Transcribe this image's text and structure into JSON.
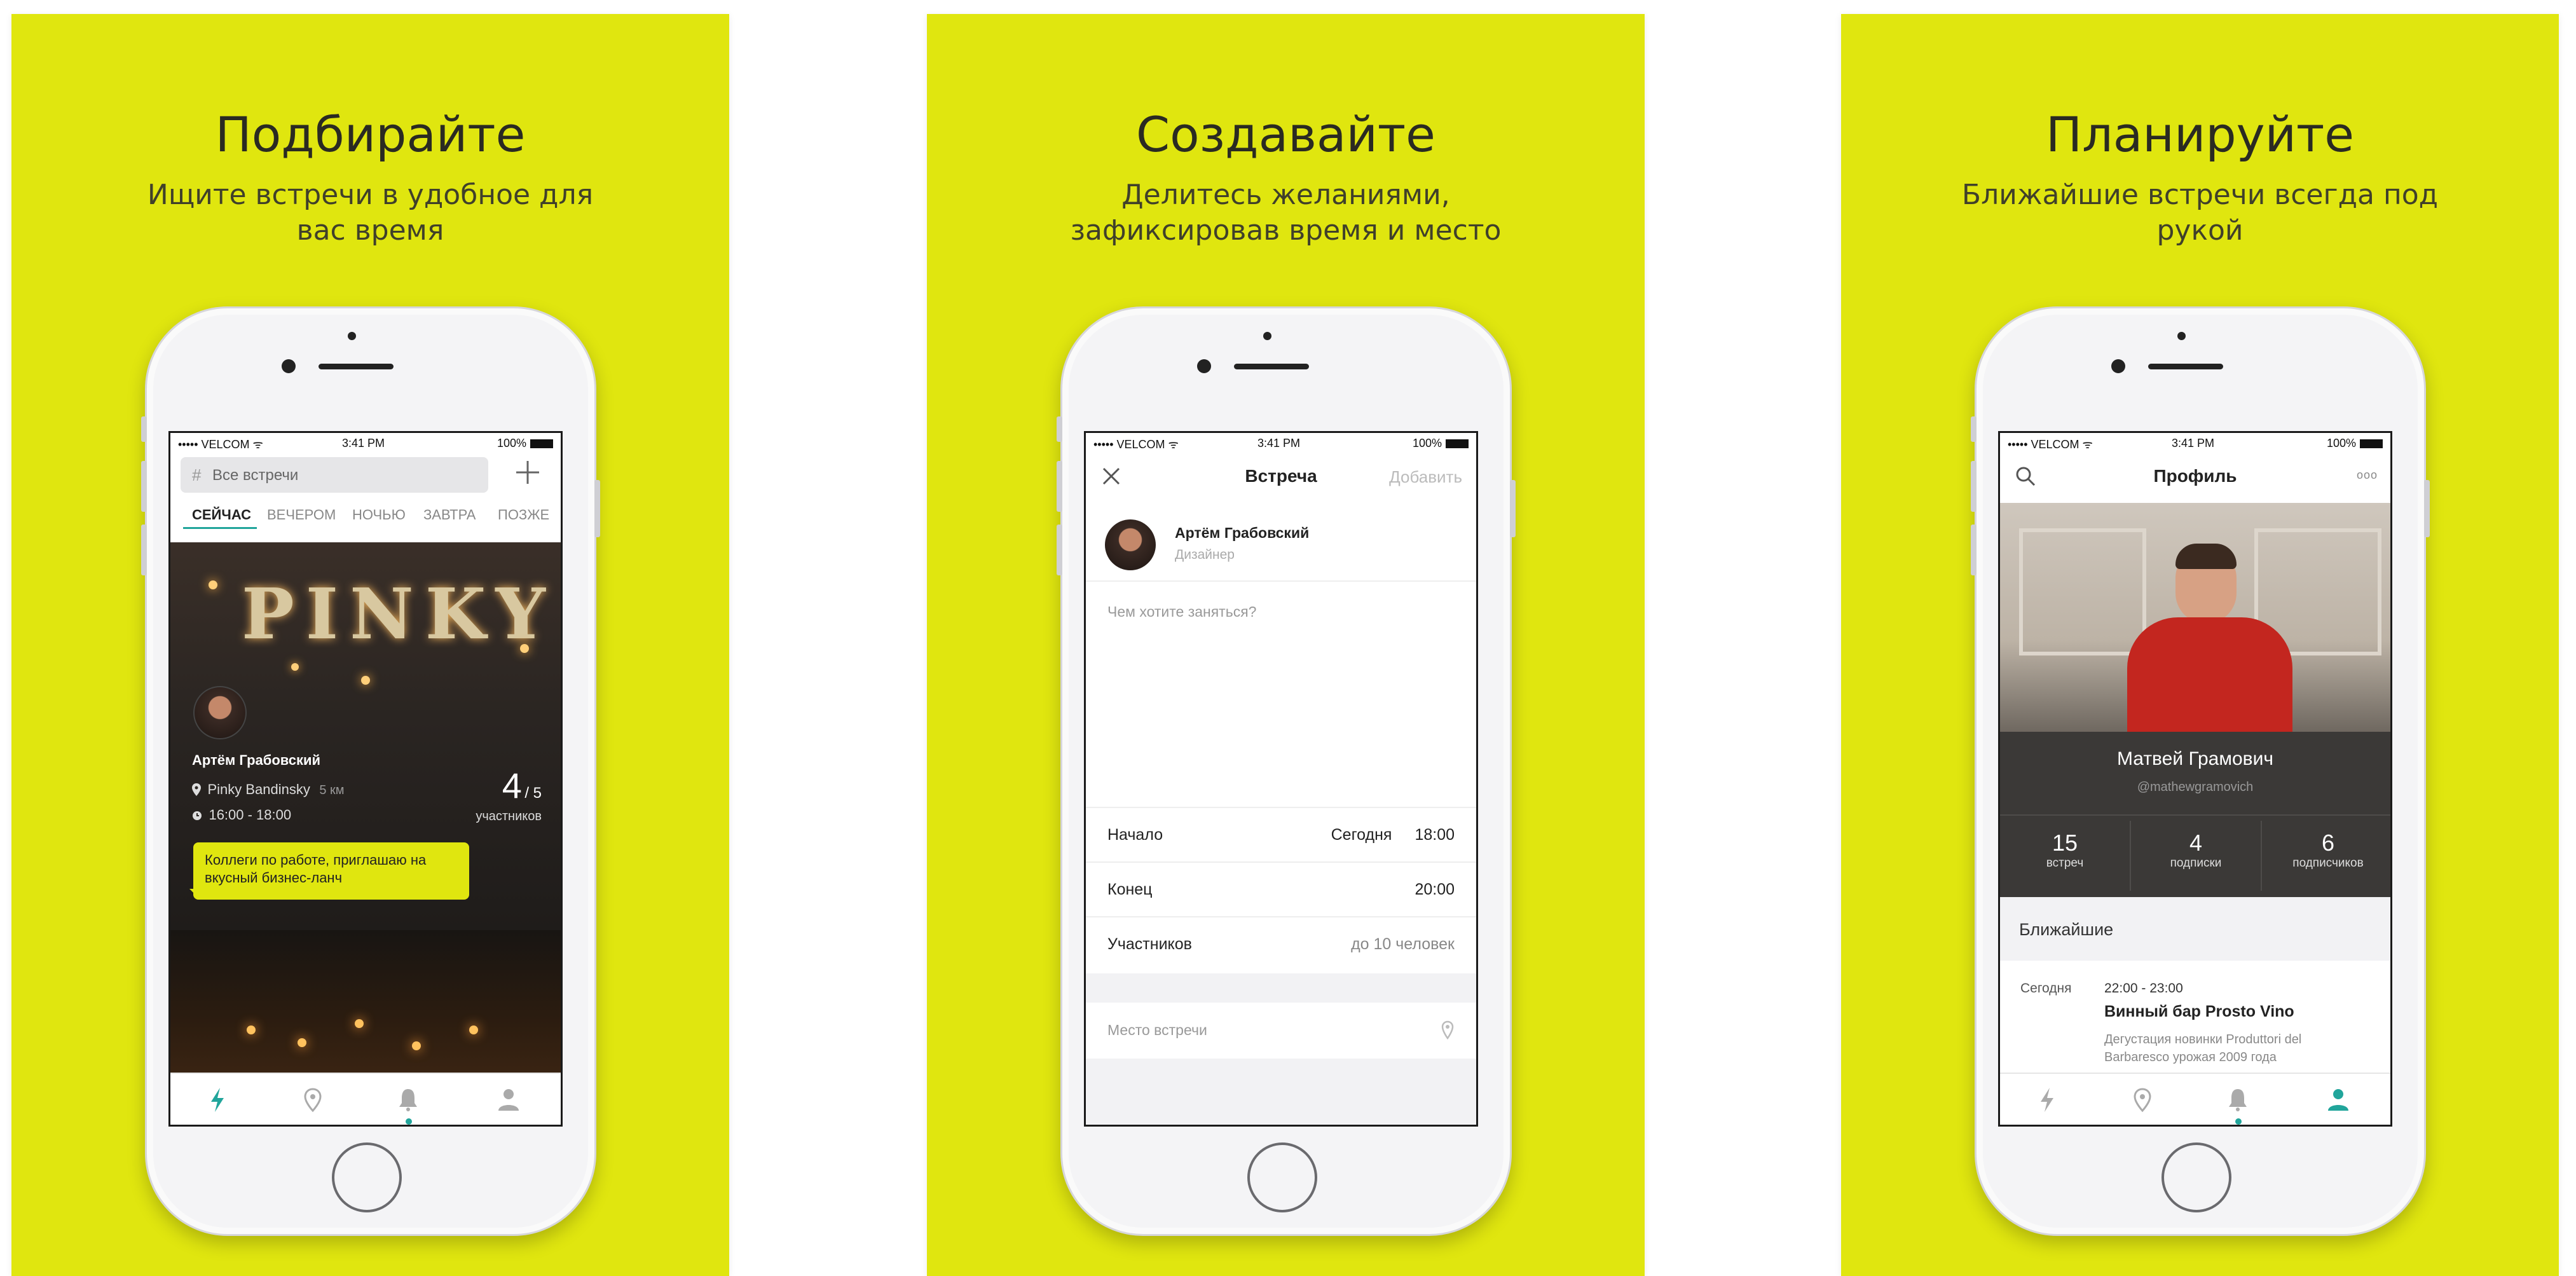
{
  "panels": [
    {
      "title": "Подбирайте",
      "subtitle": "Ищите встречи в удобное для вас время"
    },
    {
      "title": "Создавайте",
      "subtitle": "Делитесь желаниями, зафиксировав время и место"
    },
    {
      "title": "Планируйте",
      "subtitle": "Ближайшие встречи всегда под рукой"
    }
  ],
  "status": {
    "carrier": "••••• VELCOM ᯤ",
    "time": "3:41 PM",
    "battery": "100%"
  },
  "feed": {
    "search_placeholder": "Все встречи",
    "hash": "#",
    "filters": [
      "СЕЙЧАС",
      "ВЕЧЕРОМ",
      "НОЧЬЮ",
      "ЗАВТРА",
      "ПОЗЖЕ"
    ],
    "sign_text": "PINKY",
    "card": {
      "name": "Артём Грабовский",
      "place": "Pinky Bandinsky",
      "distance": "5 км",
      "time": "16:00 - 18:00",
      "count": "4",
      "count_total": "/ 5",
      "count_label": "участников",
      "message": "Коллеги по работе, приглашаю на вкусный бизнес-ланч"
    }
  },
  "create": {
    "nav_title": "Встреча",
    "add_label": "Добавить",
    "user_name": "Артём Грабовский",
    "user_role": "Дизайнер",
    "question_placeholder": "Чем хотите заняться?",
    "rows": [
      {
        "label": "Начало",
        "value_day": "Сегодня",
        "value_time": "18:00"
      },
      {
        "label": "Конец",
        "value_day": "",
        "value_time": "20:00"
      },
      {
        "label": "Участников",
        "value_day": "",
        "value_time": "до 10 человек"
      }
    ],
    "place_placeholder": "Место встречи"
  },
  "profile": {
    "nav_title": "Профиль",
    "more": "ooo",
    "name": "Матвей Грамович",
    "handle": "@mathewgramovich",
    "stats": [
      {
        "value": "15",
        "label": "встреч"
      },
      {
        "value": "4",
        "label": "подписки"
      },
      {
        "value": "6",
        "label": "подписчиков"
      }
    ],
    "section": "Ближайшие",
    "event": {
      "day": "Сегодня",
      "time": "22:00 - 23:00",
      "title": "Винный бар Prosto Vino",
      "desc": "Дегустация новинки Produttori del Barbaresco урожая 2009 года"
    }
  },
  "colors": {
    "background": "#E0E60F",
    "accent": "#21a59b",
    "bubble": "#E0E60F"
  }
}
